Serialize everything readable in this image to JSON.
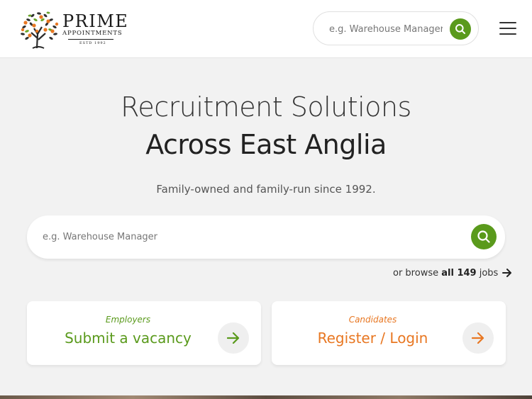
{
  "brand": {
    "name": "PRIME",
    "sub": "APPOINTMENTS",
    "estd": "ESTD 1992",
    "logo_icon": "orange-tree-icon"
  },
  "header": {
    "search_placeholder": "e.g. Warehouse Manager",
    "search_icon": "search-icon",
    "menu_icon": "hamburger-menu-icon"
  },
  "hero": {
    "line1": "Recruitment Solutions",
    "line2": "Across East Anglia",
    "tagline": "Family-owned and family-run since 1992."
  },
  "search": {
    "placeholder": "e.g. Warehouse Manager"
  },
  "browse": {
    "prefix": "or browse ",
    "strong": "all 149",
    "suffix": " jobs",
    "count": 149
  },
  "cards": {
    "employers": {
      "kicker": "Employers",
      "title": "Submit a vacancy"
    },
    "candidates": {
      "kicker": "Candidates",
      "title": "Register / Login"
    }
  },
  "colors": {
    "green": "#5a9a1c",
    "orange": "#e87722",
    "background": "#f2f2f2"
  }
}
